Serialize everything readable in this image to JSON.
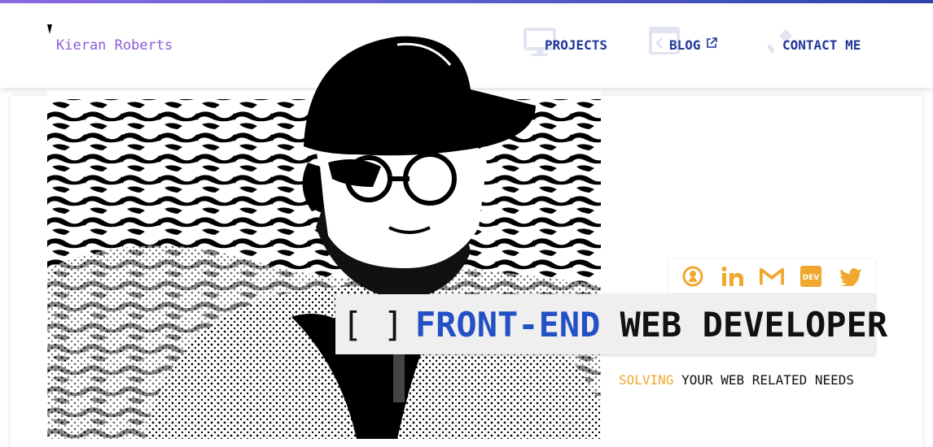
{
  "brand": {
    "name": "Kieran Roberts"
  },
  "nav": {
    "projects": {
      "label": "PROJECTS",
      "bg_icon": "monitor-icon"
    },
    "blog": {
      "label": "BLOG",
      "bg_icon": "code-window-icon",
      "link_icon": "external-link-icon"
    },
    "contact": {
      "label": "CONTACT ME",
      "bg_icon": "phone-icon"
    }
  },
  "hero": {
    "image": {
      "icon": "portrait-photo",
      "description": "black-and-white portrait"
    },
    "headline": {
      "bracket": "[ ]",
      "accent": "FRONT-END",
      "rest": "WEB DEVELOPER"
    },
    "tagline": {
      "accent": "SOLVING",
      "rest": "YOUR WEB RELATED NEEDS"
    }
  },
  "social": [
    {
      "name": "github",
      "icon": "github-icon"
    },
    {
      "name": "linkedin",
      "icon": "linkedin-icon"
    },
    {
      "name": "gmail",
      "icon": "gmail-icon"
    },
    {
      "name": "dev",
      "icon": "dev-icon",
      "label": "DEV"
    },
    {
      "name": "twitter",
      "icon": "twitter-icon"
    }
  ],
  "colors": {
    "brand": "#8a5cd8",
    "nav": "#22369a",
    "accent_blue": "#2350c5",
    "accent_orange": "#f0a830",
    "social": "#f0a830"
  }
}
